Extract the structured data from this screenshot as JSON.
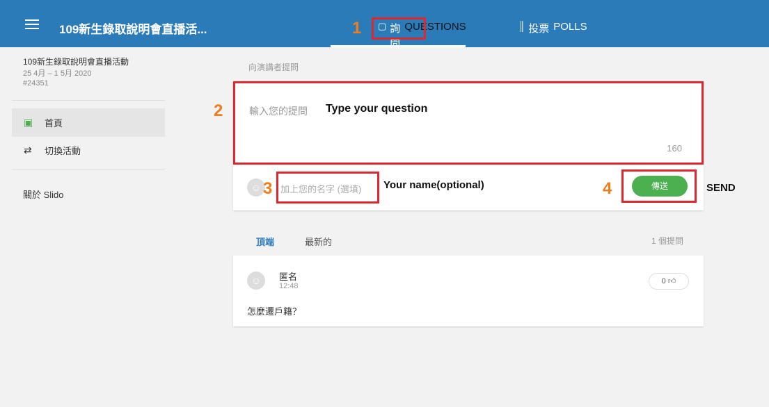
{
  "header": {
    "title": "109新生錄取說明會直播活...",
    "menu_icon": "hamburger-icon",
    "tabs": [
      {
        "icon": "chat-icon",
        "label": "詢問",
        "annotation": "QUESTIONS"
      },
      {
        "icon": "bar-chart-icon",
        "label": "投票",
        "annotation": "POLLS"
      }
    ]
  },
  "sidebar": {
    "event_name": "109新生錄取說明會直播活動",
    "event_dates": "25 4月 – 1 5月 2020",
    "event_code": "#24351",
    "items": [
      {
        "icon": "chat-icon",
        "label": "首頁"
      },
      {
        "icon": "switch-icon",
        "label": "切換活動"
      }
    ],
    "about": "關於 Slido"
  },
  "ask": {
    "title": "向演講者提問",
    "placeholder": "輸入您的提問",
    "annotation": "Type your question",
    "counter": "160",
    "name_placeholder": "加上您的名字 (選填)",
    "name_annotation": "Your name(optional)",
    "send_label": "傳送",
    "send_annotation": "SEND"
  },
  "list": {
    "tabs": [
      "頂端",
      "最新的"
    ],
    "count_label": "1 個提問",
    "questions": [
      {
        "author": "匿名",
        "time": "12:48",
        "text": "怎麼遷戶籍？",
        "likes": "0"
      }
    ]
  },
  "annotations": {
    "numbers": [
      "1",
      "2",
      "3",
      "4"
    ]
  },
  "colors": {
    "header": "#2b7bb9",
    "accent_green": "#4caf50",
    "highlight_red": "#e0262f",
    "number_orange": "#f07c1b"
  }
}
